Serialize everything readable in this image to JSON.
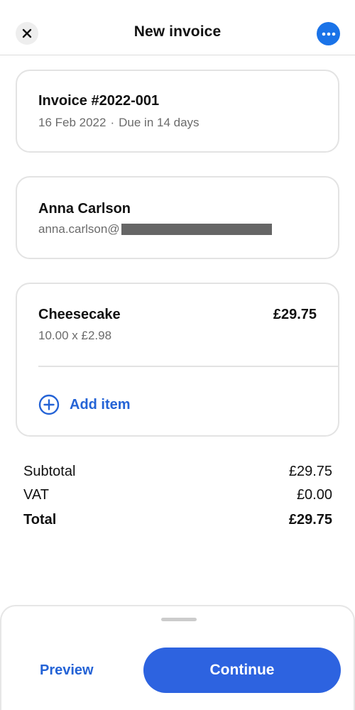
{
  "header": {
    "title": "New invoice",
    "close_icon": "close-icon",
    "more_icon": "more-horizontal-icon",
    "accent_color": "#1a73e8"
  },
  "invoice": {
    "number": "Invoice #2022-001",
    "date": "16 Feb 2022",
    "separator": "·",
    "due": "Due in 14 days"
  },
  "client": {
    "name": "Anna Carlson",
    "email_prefix": "anna.carlson@"
  },
  "items": [
    {
      "name": "Cheesecake",
      "price": "£29.75",
      "quantity_line": "10.00 x £2.98"
    }
  ],
  "add_item": {
    "label": "Add item",
    "icon": "plus-circle-icon"
  },
  "totals": {
    "subtotal_label": "Subtotal",
    "subtotal_value": "£29.75",
    "vat_label": "VAT",
    "vat_value": "£0.00",
    "total_label": "Total",
    "total_value": "£29.75"
  },
  "footer": {
    "preview_label": "Preview",
    "continue_label": "Continue",
    "primary_color": "#2d63e0"
  }
}
